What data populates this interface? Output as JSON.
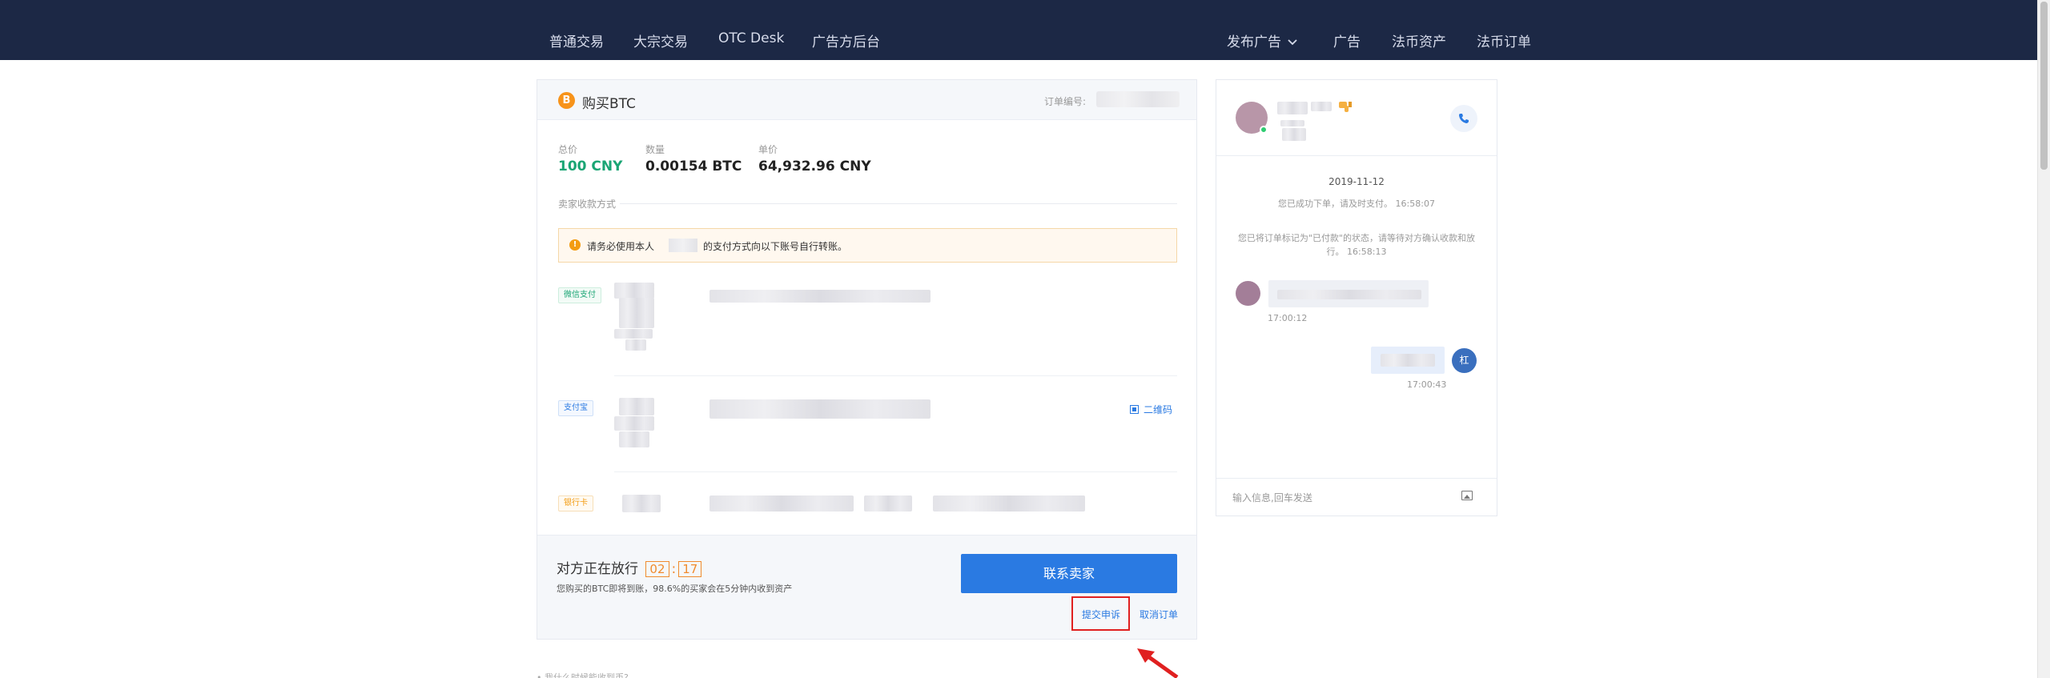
{
  "nav": {
    "left": [
      "普通交易",
      "大宗交易",
      "OTC Desk",
      "广告方后台"
    ],
    "right": [
      "发布广告",
      "广告",
      "法币资产",
      "法币订单"
    ]
  },
  "order": {
    "coin_badge": "B",
    "title": "购买BTC",
    "order_no_label": "订单编号:",
    "stats": [
      {
        "label": "总价",
        "value": "100 CNY"
      },
      {
        "label": "数量",
        "value": "0.00154 BTC"
      },
      {
        "label": "单价",
        "value": "64,932.96 CNY"
      }
    ],
    "payment_section_label": "卖家收款方式",
    "notice": {
      "icon": "!",
      "text_before": "请务必使用本人",
      "text_after": "的支付方式向以下账号自行转账。"
    },
    "payment_methods": [
      {
        "tag": "微信支付"
      },
      {
        "tag": "支付宝",
        "qr_label": "二维码"
      },
      {
        "tag": "银行卡"
      }
    ],
    "status_title": "对方正在放行",
    "timer_min": "02",
    "timer_sec": "17",
    "timer_colon": ":",
    "status_sub": "您购买的BTC即将到账，98.6%的买家会在5分钟内收到资产",
    "contact_button": "联系卖家",
    "appeal_link": "提交申诉",
    "cancel_link": "取消订单",
    "faq_hint": "• 我什么时候能收到币?"
  },
  "chat": {
    "date": "2019-11-12",
    "system_messages": [
      "您已成功下单，请及时支付。 16:58:07",
      "您已将订单标记为\"已付款\"的状态，请等待对方确认收款和放行。 16:58:13"
    ],
    "incoming_time": "17:00:12",
    "outgoing_time": "17:00:43",
    "my_avatar_text": "杠",
    "input_placeholder": "输入信息,回车发送"
  },
  "colors": {
    "nav_bg": "#1c2845",
    "accent_blue": "#2a7ae2",
    "price_green": "#1aa574",
    "timer_orange": "#f08c2e",
    "highlight_red": "#e02020"
  }
}
